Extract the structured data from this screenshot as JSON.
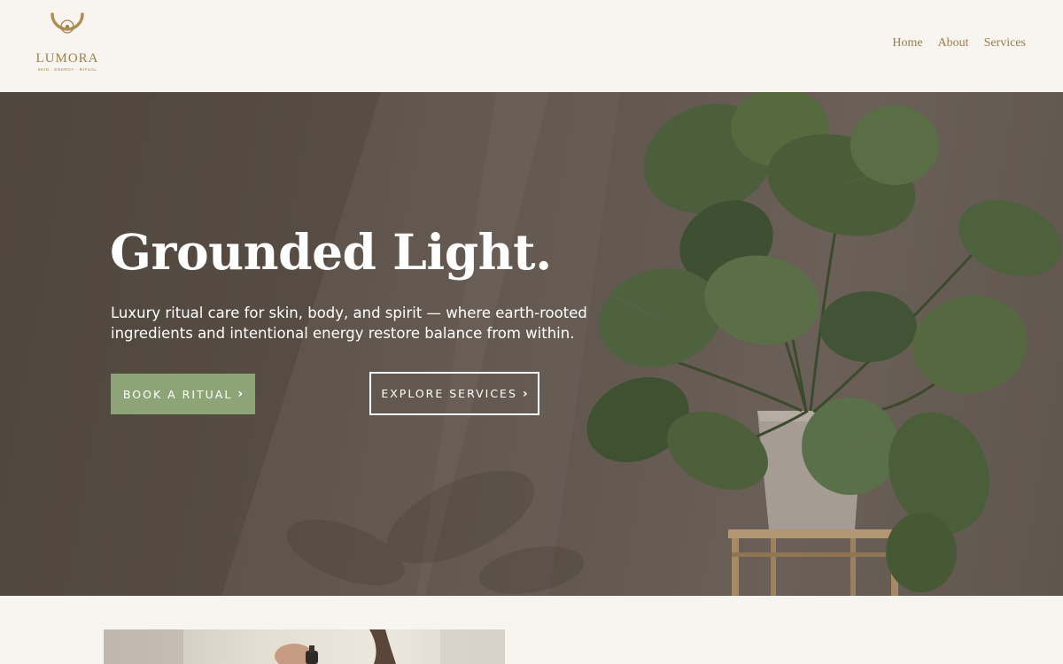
{
  "brand": {
    "name": "LUMORA",
    "tagline": "SKIN · ENERGY · RITUAL",
    "logo_icon": "sun-moon-icon",
    "color": "#9c7f4b"
  },
  "nav": {
    "items": [
      {
        "label": "Home"
      },
      {
        "label": "About"
      },
      {
        "label": "Services"
      }
    ]
  },
  "hero": {
    "title": "Grounded Light.",
    "subtitle": "Luxury ritual care for skin, body, and spirit — where earth-rooted ingredients and intentional energy restore balance from within.",
    "primary_button": {
      "label": "BOOK A RITUAL",
      "icon": "chevron-right-icon",
      "color": "#8da576"
    },
    "secondary_button": {
      "label": "EXPLORE SERVICES",
      "icon": "chevron-right-icon"
    },
    "image": "monstera-plant-on-wooden-stand"
  },
  "section_two": {
    "image": "person-holding-dropper-bottle"
  }
}
